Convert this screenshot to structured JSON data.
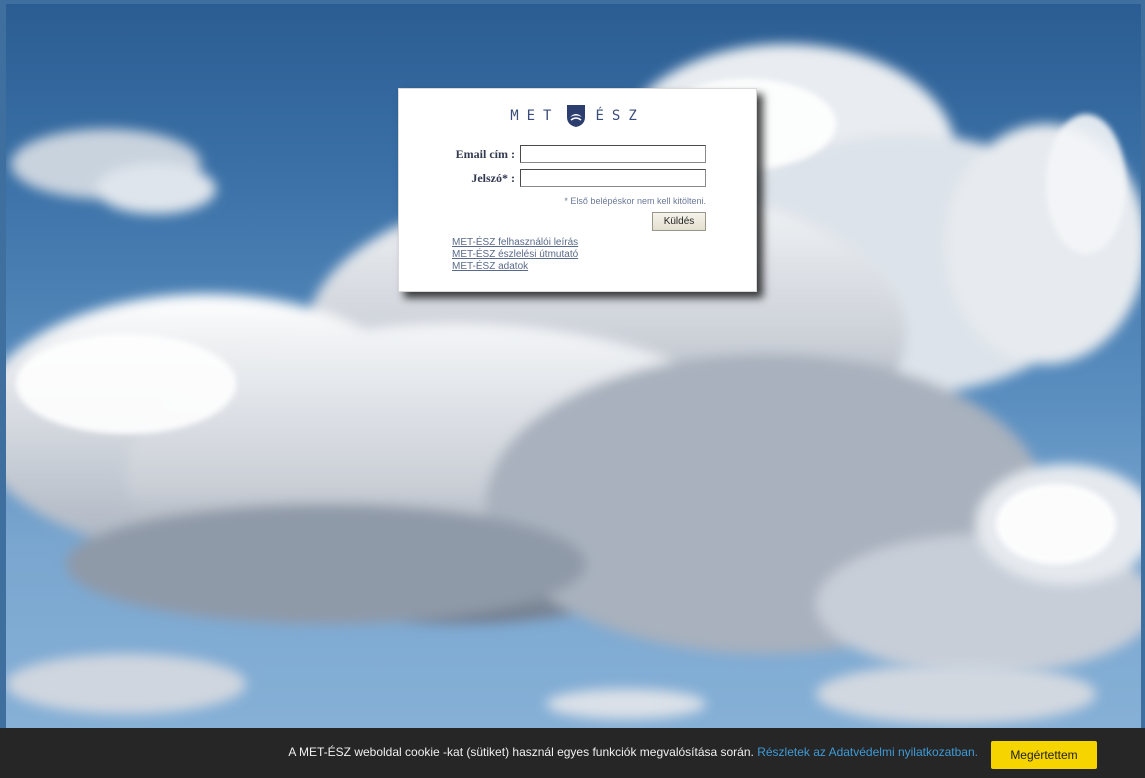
{
  "background": {
    "icon": "cloudy-sky-photo"
  },
  "logo": {
    "left_text": "MET",
    "right_text": "ÉSZ",
    "icon": "omsz-shield-icon",
    "color": "#3a4d7a"
  },
  "login": {
    "email_label": "Email cím :",
    "email_value": "",
    "password_label": "Jelszó* :",
    "password_value": "",
    "note": "* Első belépéskor nem kell kitölteni.",
    "submit_label": "Küldés"
  },
  "links": [
    {
      "label": "MET-ÉSZ felhasználói leírás"
    },
    {
      "label": "MET-ÉSZ észlelési útmutató"
    },
    {
      "label": "MET-ÉSZ adatok"
    }
  ],
  "cookie_bar": {
    "text": "A MET-ÉSZ weboldal cookie -kat (sütiket) használ egyes funkciók megvalósítása során.",
    "link_text": "Részletek az Adatvédelmi nyilatkozatban.",
    "button_label": "Megértettem",
    "button_color": "#f6d400",
    "link_color": "#3f9ad6"
  }
}
